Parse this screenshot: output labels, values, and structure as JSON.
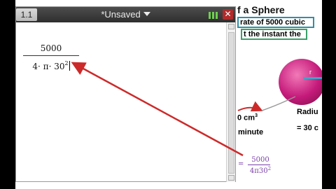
{
  "calculator": {
    "tab_number": "1.1",
    "document_title": "*Unsaved",
    "close_label": "✕",
    "expression": {
      "numerator": "5000",
      "denominator_base": "4· π· 30",
      "denominator_exponent": "2"
    }
  },
  "slide": {
    "title": "f a Sphere",
    "line1": "rate of 5000 cubic",
    "line2": "t the instant the",
    "unit_text": "0 cm",
    "unit_exp": "3",
    "minute_text": "minute",
    "radius_label": "Radiu",
    "radius_value": "= 30 c",
    "sphere_label": "r",
    "result_num": "5000",
    "result_den": "4π30",
    "result_exp": "2",
    "result_eq": "="
  },
  "colors": {
    "arrow": "#cc2a2a",
    "sphere": "#c41a7a",
    "result_text": "#7a3fa8",
    "box1_border": "#2f8fa6",
    "box2_border": "#3aa06a"
  }
}
